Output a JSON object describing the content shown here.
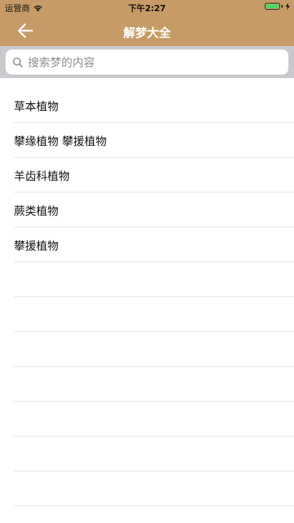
{
  "status_bar": {
    "carrier": "运营商",
    "time": "下午2:27",
    "icons": [
      "wifi-icon",
      "battery-icon",
      "charging-bolt-icon"
    ]
  },
  "nav": {
    "title": "解梦大全",
    "back_icon": "arrow-left-icon"
  },
  "search": {
    "placeholder": "搜索梦的内容",
    "value": "",
    "icon": "search-icon"
  },
  "list": {
    "items": [
      {
        "label": "草本植物"
      },
      {
        "label": "攀缘植物 攀援植物"
      },
      {
        "label": "羊齿科植物"
      },
      {
        "label": "蕨类植物"
      },
      {
        "label": "攀援植物"
      }
    ]
  },
  "colors": {
    "nav_background": "#c79b67",
    "search_area_background": "#c9c9ce",
    "separator": "#e3e3e6",
    "battery_fill": "#4cd964"
  }
}
